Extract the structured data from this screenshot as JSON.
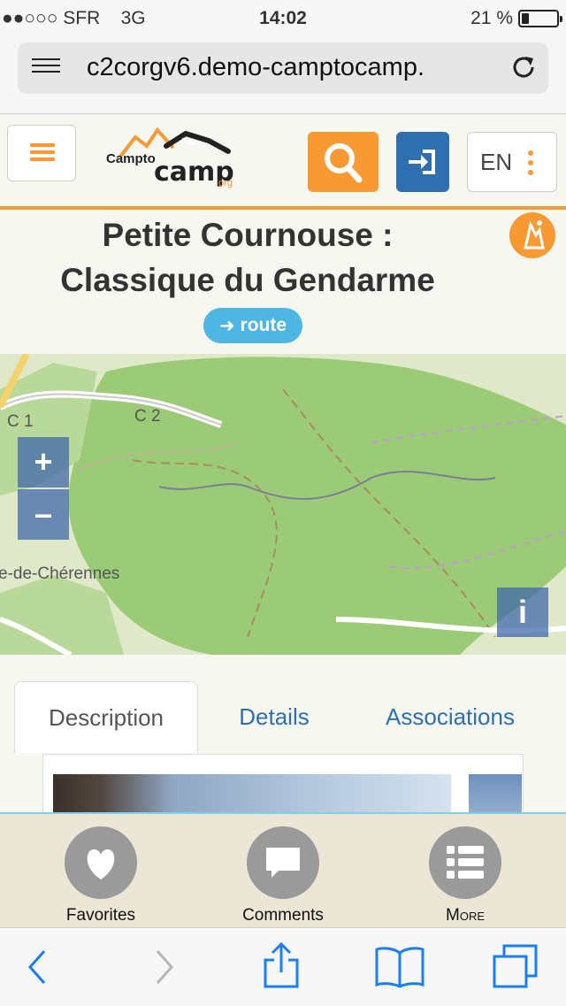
{
  "status_bar": {
    "signal": "●●○○○",
    "carrier": "SFR",
    "network": "3G",
    "time": "14:02",
    "battery_percent": "21 %",
    "battery_level": 0.21
  },
  "browser": {
    "url": "c2corgv6.demo-camptocamp.",
    "reader_icon": "reader-list-icon",
    "reload_icon": "reload-icon"
  },
  "header": {
    "menu_icon": "hamburger-icon",
    "logo_text_1": "Campto",
    "logo_text_2": "camp",
    "logo_suffix": ".org",
    "search_icon": "search-icon",
    "login_icon": "login-icon",
    "lang_label": "EN"
  },
  "title": {
    "line1": "Petite Cournouse :",
    "line2": "Classique du Gendarme",
    "badge": "route",
    "badge_icon": "arrow-right-icon"
  },
  "map": {
    "zoom_in": "+",
    "zoom_out": "–",
    "info": "i",
    "labels": [
      "C 1",
      "C 2",
      "e-de-Chérennes"
    ]
  },
  "tabs": [
    {
      "label": "Description",
      "active": true
    },
    {
      "label": "Details",
      "active": false
    },
    {
      "label": "Associations",
      "active": false
    }
  ],
  "actions": [
    {
      "label": "Favorites",
      "icon": "heart-icon"
    },
    {
      "label": "Comments",
      "icon": "comment-icon"
    },
    {
      "label": "More",
      "icon": "list-icon"
    }
  ],
  "colors": {
    "accent_orange": "#f89a33",
    "login_blue": "#2f6fb0",
    "route_badge": "#4db6e2",
    "map_overlay": "#3c64aa"
  }
}
